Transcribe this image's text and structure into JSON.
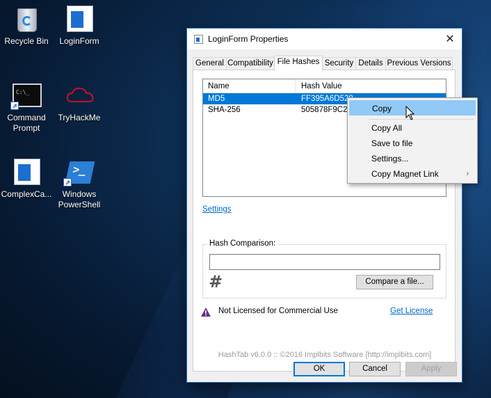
{
  "desktop": {
    "icons": [
      {
        "label": "Recycle Bin"
      },
      {
        "label": "LoginForm"
      },
      {
        "label": "Command Prompt"
      },
      {
        "label": "TryHackMe"
      },
      {
        "label": "ComplexCa..."
      },
      {
        "label": "Windows PowerShell"
      }
    ],
    "tryhackme_logo_text": "Try Hack Me",
    "cmd_icon_text": "C:\\_"
  },
  "dialog": {
    "title": "LoginForm Properties",
    "close_glyph": "✕",
    "tabs": [
      {
        "label": "General"
      },
      {
        "label": "Compatibility"
      },
      {
        "label": "File Hashes",
        "active": true
      },
      {
        "label": "Security"
      },
      {
        "label": "Details"
      },
      {
        "label": "Previous Versions"
      }
    ],
    "hash_list": {
      "columns": [
        "Name",
        "Hash Value"
      ],
      "rows": [
        {
          "name": "MD5",
          "value": "FF395A6D528",
          "selected": true
        },
        {
          "name": "SHA-256",
          "value": "505878F9C2C"
        }
      ]
    },
    "settings_link": "Settings",
    "hash_comparison": {
      "label": "Hash Comparison:",
      "value": "",
      "glyph": "#",
      "compare_button": "Compare a file..."
    },
    "license": {
      "text": "Not Licensed for Commercial Use",
      "link": "Get License"
    },
    "footer": "HashTab v6.0.0 :: ©2016 Implbits Software [http://implbits.com]",
    "buttons": {
      "ok": "OK",
      "cancel": "Cancel",
      "apply": "Apply"
    }
  },
  "context_menu": {
    "items": [
      {
        "label": "Copy",
        "highlighted": true
      },
      {
        "label": "Copy All"
      },
      {
        "label": "Save to file"
      },
      {
        "label": "Settings..."
      },
      {
        "label": "Copy Magnet Link",
        "submenu_arrow": "›"
      }
    ]
  },
  "colors": {
    "selection": "#0078d7",
    "menu_highlight": "#91c9f7",
    "link": "#0066cc",
    "warning_icon": "#6b2d8a"
  }
}
